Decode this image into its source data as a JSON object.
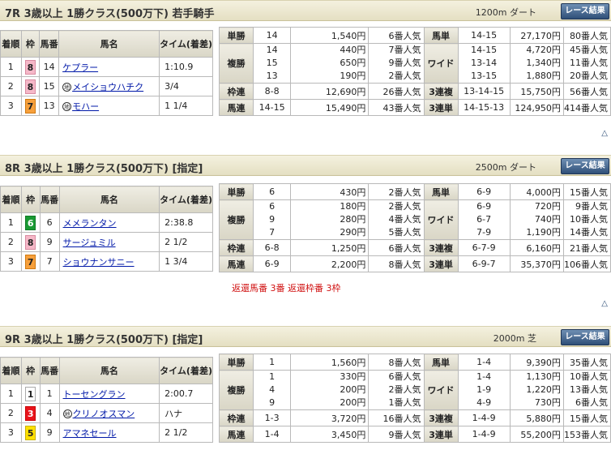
{
  "labels": {
    "finish_h": "着順",
    "waku_h": "枠",
    "uma_h": "馬番",
    "name_h": "馬名",
    "time_h": "タイム(着差)",
    "maru_chi": "地",
    "result_btn": "レース結果",
    "up": "△"
  },
  "races": [
    {
      "title": "7R 3歳以上 1勝クラス(500万下) 若手騎手",
      "dist": "1200m ダート",
      "results": [
        {
          "pos": "1",
          "waku": "8",
          "uma": "14",
          "name": "ケプラー",
          "chi": false,
          "time": "1:10.9"
        },
        {
          "pos": "2",
          "waku": "8",
          "uma": "15",
          "name": "メイショウハチク",
          "chi": true,
          "time": "3/4"
        },
        {
          "pos": "3",
          "waku": "7",
          "uma": "13",
          "name": "モハー",
          "chi": true,
          "time": "1 1/4"
        }
      ],
      "pay": {
        "tan": {
          "label": "単勝",
          "combo": "14",
          "amt": "1,540円",
          "pop": "6番人気"
        },
        "fuku": {
          "label": "複勝",
          "rows": [
            {
              "combo": "14",
              "amt": "440円",
              "pop": "7番人気"
            },
            {
              "combo": "15",
              "amt": "650円",
              "pop": "9番人気"
            },
            {
              "combo": "13",
              "amt": "190円",
              "pop": "2番人気"
            }
          ]
        },
        "umatan": {
          "label": "馬単",
          "combo": "14-15",
          "amt": "27,170円",
          "pop": "80番人気"
        },
        "wide": {
          "label": "ワイド",
          "rows": [
            {
              "combo": "14-15",
              "amt": "4,720円",
              "pop": "45番人気"
            },
            {
              "combo": "13-14",
              "amt": "1,340円",
              "pop": "11番人気"
            },
            {
              "combo": "13-15",
              "amt": "1,880円",
              "pop": "20番人気"
            }
          ]
        },
        "wakuren": {
          "label": "枠連",
          "combo": "8-8",
          "amt": "12,690円",
          "pop": "26番人気"
        },
        "sanfuku": {
          "label": "3連複",
          "combo": "13-14-15",
          "amt": "15,750円",
          "pop": "56番人気"
        },
        "umaren": {
          "label": "馬連",
          "combo": "14-15",
          "amt": "15,490円",
          "pop": "43番人気"
        },
        "santan": {
          "label": "3連単",
          "combo": "14-15-13",
          "amt": "124,950円",
          "pop": "414番人気"
        }
      },
      "refund": ""
    },
    {
      "title": "8R 3歳以上 1勝クラス(500万下) [指定]",
      "dist": "2500m ダート",
      "results": [
        {
          "pos": "1",
          "waku": "6",
          "uma": "6",
          "name": "メメランタン",
          "chi": false,
          "time": "2:38.8"
        },
        {
          "pos": "2",
          "waku": "8",
          "uma": "9",
          "name": "サージュミル",
          "chi": false,
          "time": "2 1/2"
        },
        {
          "pos": "3",
          "waku": "7",
          "uma": "7",
          "name": "ショウナンサニー",
          "chi": false,
          "time": "1 3/4"
        }
      ],
      "pay": {
        "tan": {
          "label": "単勝",
          "combo": "6",
          "amt": "430円",
          "pop": "2番人気"
        },
        "fuku": {
          "label": "複勝",
          "rows": [
            {
              "combo": "6",
              "amt": "180円",
              "pop": "2番人気"
            },
            {
              "combo": "9",
              "amt": "280円",
              "pop": "4番人気"
            },
            {
              "combo": "7",
              "amt": "290円",
              "pop": "5番人気"
            }
          ]
        },
        "umatan": {
          "label": "馬単",
          "combo": "6-9",
          "amt": "4,000円",
          "pop": "15番人気"
        },
        "wide": {
          "label": "ワイド",
          "rows": [
            {
              "combo": "6-9",
              "amt": "720円",
              "pop": "9番人気"
            },
            {
              "combo": "6-7",
              "amt": "740円",
              "pop": "10番人気"
            },
            {
              "combo": "7-9",
              "amt": "1,190円",
              "pop": "14番人気"
            }
          ]
        },
        "wakuren": {
          "label": "枠連",
          "combo": "6-8",
          "amt": "1,250円",
          "pop": "6番人気"
        },
        "sanfuku": {
          "label": "3連複",
          "combo": "6-7-9",
          "amt": "6,160円",
          "pop": "21番人気"
        },
        "umaren": {
          "label": "馬連",
          "combo": "6-9",
          "amt": "2,200円",
          "pop": "8番人気"
        },
        "santan": {
          "label": "3連単",
          "combo": "6-9-7",
          "amt": "35,370円",
          "pop": "106番人気"
        }
      },
      "refund": "返還馬番 3番 返還枠番 3枠"
    },
    {
      "title": "9R 3歳以上 1勝クラス(500万下) [指定]",
      "dist": "2000m 芝",
      "results": [
        {
          "pos": "1",
          "waku": "1",
          "uma": "1",
          "name": "トーセングラン",
          "chi": false,
          "time": "2:00.7"
        },
        {
          "pos": "2",
          "waku": "3",
          "uma": "4",
          "name": "クリノオスマン",
          "chi": true,
          "time": "ハナ"
        },
        {
          "pos": "3",
          "waku": "5",
          "uma": "9",
          "name": "アマネセール",
          "chi": false,
          "time": "2 1/2"
        }
      ],
      "pay": {
        "tan": {
          "label": "単勝",
          "combo": "1",
          "amt": "1,560円",
          "pop": "8番人気"
        },
        "fuku": {
          "label": "複勝",
          "rows": [
            {
              "combo": "1",
              "amt": "330円",
              "pop": "6番人気"
            },
            {
              "combo": "4",
              "amt": "200円",
              "pop": "2番人気"
            },
            {
              "combo": "9",
              "amt": "200円",
              "pop": "1番人気"
            }
          ]
        },
        "umatan": {
          "label": "馬単",
          "combo": "1-4",
          "amt": "9,390円",
          "pop": "35番人気"
        },
        "wide": {
          "label": "ワイド",
          "rows": [
            {
              "combo": "1-4",
              "amt": "1,130円",
              "pop": "10番人気"
            },
            {
              "combo": "1-9",
              "amt": "1,220円",
              "pop": "13番人気"
            },
            {
              "combo": "4-9",
              "amt": "730円",
              "pop": "6番人気"
            }
          ]
        },
        "wakuren": {
          "label": "枠連",
          "combo": "1-3",
          "amt": "3,720円",
          "pop": "16番人気"
        },
        "sanfuku": {
          "label": "3連複",
          "combo": "1-4-9",
          "amt": "5,880円",
          "pop": "15番人気"
        },
        "umaren": {
          "label": "馬連",
          "combo": "1-4",
          "amt": "3,450円",
          "pop": "9番人気"
        },
        "santan": {
          "label": "3連単",
          "combo": "1-4-9",
          "amt": "55,200円",
          "pop": "153番人気"
        }
      },
      "refund": ""
    }
  ]
}
